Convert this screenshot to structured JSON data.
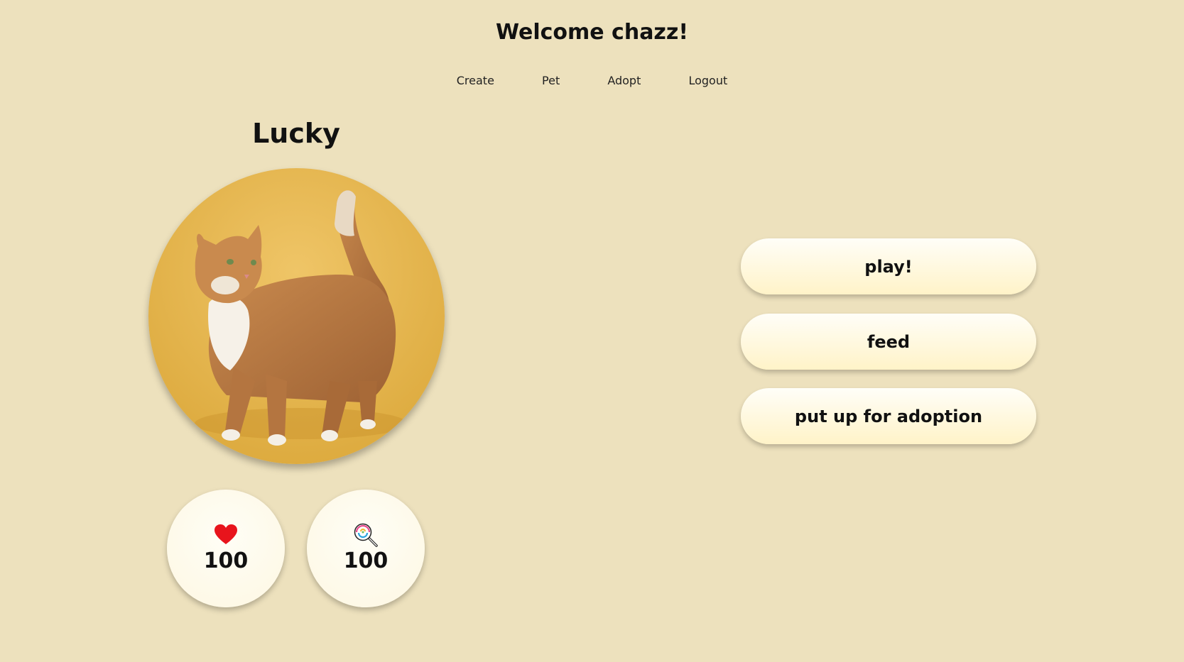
{
  "header": {
    "welcome": "Welcome chazz!"
  },
  "nav": {
    "items": [
      {
        "label": "Create"
      },
      {
        "label": "Pet"
      },
      {
        "label": "Adopt"
      },
      {
        "label": "Logout"
      }
    ]
  },
  "pet": {
    "name": "Lucky",
    "photo_icon": "orange-cat-photo",
    "stats": {
      "health": {
        "icon": "heart-icon",
        "value": "100"
      },
      "hunger": {
        "icon": "lollipop-icon",
        "value": "100"
      }
    }
  },
  "actions": {
    "play_label": "play!",
    "feed_label": "feed",
    "adopt_label": "put up for adoption"
  },
  "colors": {
    "background": "#ede1bd",
    "button_top": "#fffef8",
    "button_bottom": "#fff3c8",
    "heart": "#e8141c"
  }
}
